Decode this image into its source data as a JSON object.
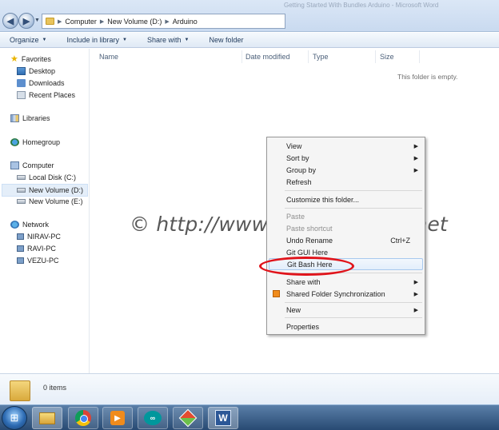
{
  "window": {
    "title": "Getting Started With Bundles Arduino - Microsoft Word"
  },
  "address": {
    "crumbs": [
      "Computer",
      "New Volume (D:)",
      "Arduino"
    ]
  },
  "toolbar": {
    "organize": "Organize",
    "include_in_library": "Include in library",
    "share_with": "Share with",
    "new_folder": "New folder"
  },
  "nav": {
    "favorites": "Favorites",
    "desktop": "Desktop",
    "downloads": "Downloads",
    "recent_places": "Recent Places",
    "libraries": "Libraries",
    "homegroup": "Homegroup",
    "computer": "Computer",
    "local_disk_c": "Local Disk (C:)",
    "new_volume_d": "New Volume (D:)",
    "new_volume_e": "New Volume (E:)",
    "network": "Network",
    "pc1": "NIRAV-PC",
    "pc2": "RAVI-PC",
    "pc3": "VEZU-PC"
  },
  "content": {
    "columns": [
      "Name",
      "Date modified",
      "Type",
      "Size"
    ],
    "empty_message": "This folder is empty."
  },
  "context_menu": {
    "view": "View",
    "sort_by": "Sort by",
    "group_by": "Group by",
    "refresh": "Refresh",
    "customize": "Customize this folder...",
    "paste": "Paste",
    "paste_shortcut": "Paste shortcut",
    "undo_rename": "Undo Rename",
    "undo_shortcut": "Ctrl+Z",
    "git_gui": "Git GUI Here",
    "git_bash": "Git Bash Here",
    "share_with": "Share with",
    "shared_folder_sync": "Shared Folder Synchronization",
    "new": "New",
    "properties": "Properties"
  },
  "watermark": "©  http://www.codeoverflow.net",
  "details": {
    "item_count": "0 items"
  },
  "taskbar": {
    "apps": [
      "windows-explorer",
      "google-chrome",
      "media-player",
      "arduino-ide",
      "git-tool",
      "microsoft-word"
    ]
  },
  "colors": {
    "highlight_ring": "#e0141b",
    "toolbar_text": "#1e395b"
  }
}
